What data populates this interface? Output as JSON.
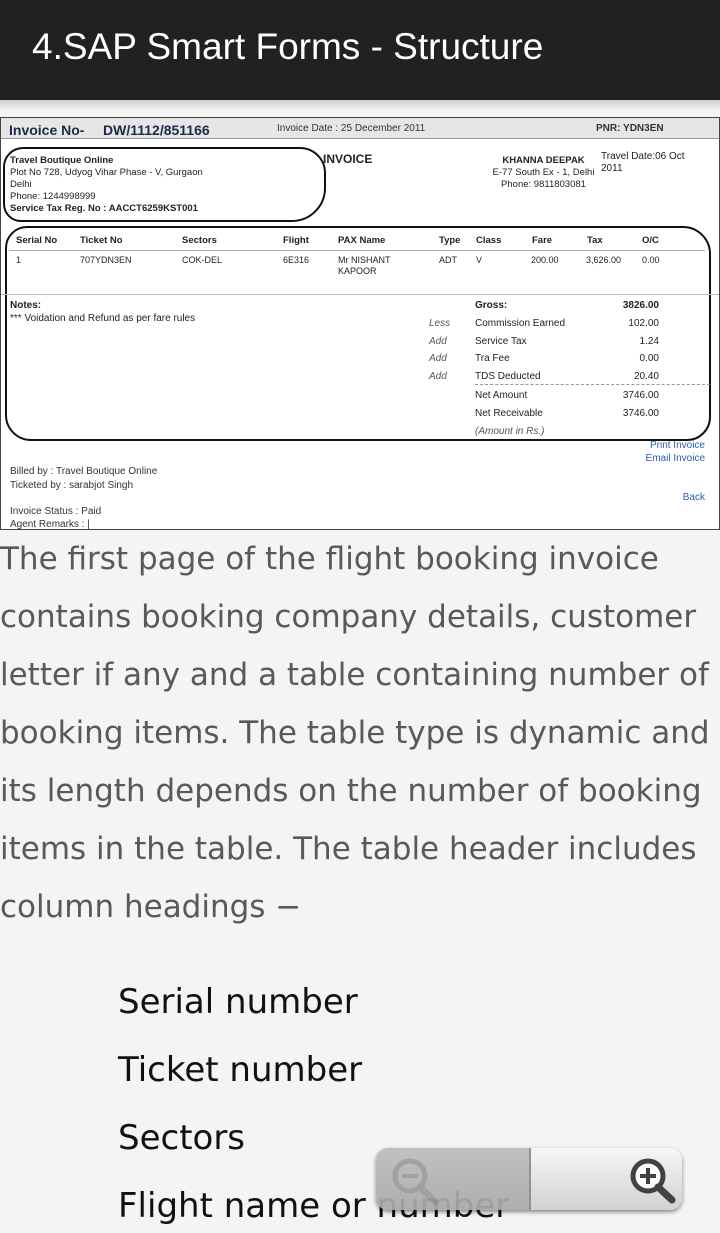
{
  "appbar": {
    "title": "4.SAP Smart Forms - Structure"
  },
  "invoice": {
    "no_label": "Invoice No-",
    "no_value": "DW/1112/851166",
    "date": "Invoice Date : 25 December 2011",
    "pnr": "PNR: YDN3EN",
    "seller": {
      "name": "Travel Boutique Online",
      "address1": "Plot No 728, Udyog Vihar Phase - V, Gurgaon",
      "city": "Delhi",
      "phone": "Phone: 1244998999",
      "tax": "Service Tax Reg. No : AACCT6259KST001"
    },
    "title": "INVOICE",
    "customer": {
      "name": "KHANNA DEEPAK",
      "address": "E-77 South Ex - 1, Delhi",
      "phone": "Phone: 9811803081"
    },
    "travel_date": "Travel Date:06 Oct 2011",
    "headers": [
      "Serial No",
      "Ticket No",
      "Sectors",
      "Flight",
      "PAX Name",
      "Type",
      "Class",
      "Fare",
      "Tax",
      "O/C"
    ],
    "row": [
      "1",
      "707YDN3EN",
      "COK-DEL",
      "6E316",
      "Mr NISHANT KAPOOR",
      "ADT",
      "V",
      "200.00",
      "3,626.00",
      "0.00"
    ],
    "notes_label": "Notes:",
    "notes_text": "*** Voidation and Refund as per fare rules",
    "summary": [
      {
        "op": "",
        "label": "Gross:",
        "value": "3826.00"
      },
      {
        "op": "Less",
        "label": "Commission Earned",
        "value": "102.00"
      },
      {
        "op": "Add",
        "label": "Service Tax",
        "value": "1.24"
      },
      {
        "op": "Add",
        "label": "Tra Fee",
        "value": "0.00"
      },
      {
        "op": "Add",
        "label": "TDS Deducted",
        "value": "20.40"
      },
      {
        "op": "",
        "label": "Net Amount",
        "value": "3746.00"
      },
      {
        "op": "",
        "label": "Net Receivable",
        "value": "3746.00"
      }
    ],
    "amount_note": "(Amount in Rs.)",
    "print_link": "Print Invoice",
    "email_link": "Email Invoice",
    "back_link": "Back",
    "billed_by": "Billed by : Travel Boutique Online",
    "ticketed_by": "Ticketed by : sarabjot Singh",
    "status": "Invoice Status : Paid",
    "agent_remarks": "Agent Remarks : |"
  },
  "description": "The first page of the flight booking invoice contains booking company details, customer letter if any and a table containing number of booking items. The table type is dynamic and its length depends on the number of booking items in the table. The table header includes column headings −",
  "list": [
    "Serial number",
    "Ticket number",
    "Sectors",
    "Flight name or number"
  ],
  "zoom": {
    "out_icon": "zoom-out-icon",
    "in_icon": "zoom-in-icon"
  }
}
